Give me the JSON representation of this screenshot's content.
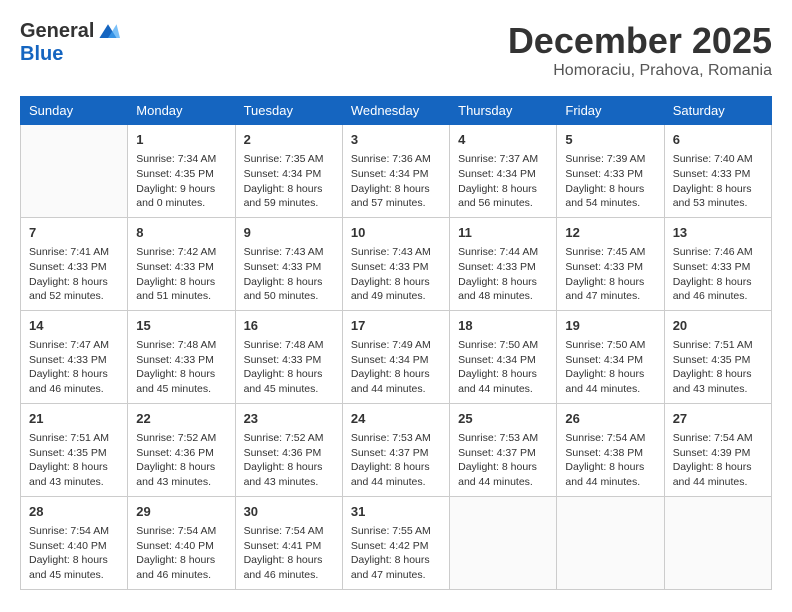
{
  "header": {
    "logo_general": "General",
    "logo_blue": "Blue",
    "month": "December 2025",
    "location": "Homoraciu, Prahova, Romania"
  },
  "days_of_week": [
    "Sunday",
    "Monday",
    "Tuesday",
    "Wednesday",
    "Thursday",
    "Friday",
    "Saturday"
  ],
  "weeks": [
    [
      {
        "day": "",
        "content": ""
      },
      {
        "day": "1",
        "content": "Sunrise: 7:34 AM\nSunset: 4:35 PM\nDaylight: 9 hours\nand 0 minutes."
      },
      {
        "day": "2",
        "content": "Sunrise: 7:35 AM\nSunset: 4:34 PM\nDaylight: 8 hours\nand 59 minutes."
      },
      {
        "day": "3",
        "content": "Sunrise: 7:36 AM\nSunset: 4:34 PM\nDaylight: 8 hours\nand 57 minutes."
      },
      {
        "day": "4",
        "content": "Sunrise: 7:37 AM\nSunset: 4:34 PM\nDaylight: 8 hours\nand 56 minutes."
      },
      {
        "day": "5",
        "content": "Sunrise: 7:39 AM\nSunset: 4:33 PM\nDaylight: 8 hours\nand 54 minutes."
      },
      {
        "day": "6",
        "content": "Sunrise: 7:40 AM\nSunset: 4:33 PM\nDaylight: 8 hours\nand 53 minutes."
      }
    ],
    [
      {
        "day": "7",
        "content": "Sunrise: 7:41 AM\nSunset: 4:33 PM\nDaylight: 8 hours\nand 52 minutes."
      },
      {
        "day": "8",
        "content": "Sunrise: 7:42 AM\nSunset: 4:33 PM\nDaylight: 8 hours\nand 51 minutes."
      },
      {
        "day": "9",
        "content": "Sunrise: 7:43 AM\nSunset: 4:33 PM\nDaylight: 8 hours\nand 50 minutes."
      },
      {
        "day": "10",
        "content": "Sunrise: 7:43 AM\nSunset: 4:33 PM\nDaylight: 8 hours\nand 49 minutes."
      },
      {
        "day": "11",
        "content": "Sunrise: 7:44 AM\nSunset: 4:33 PM\nDaylight: 8 hours\nand 48 minutes."
      },
      {
        "day": "12",
        "content": "Sunrise: 7:45 AM\nSunset: 4:33 PM\nDaylight: 8 hours\nand 47 minutes."
      },
      {
        "day": "13",
        "content": "Sunrise: 7:46 AM\nSunset: 4:33 PM\nDaylight: 8 hours\nand 46 minutes."
      }
    ],
    [
      {
        "day": "14",
        "content": "Sunrise: 7:47 AM\nSunset: 4:33 PM\nDaylight: 8 hours\nand 46 minutes."
      },
      {
        "day": "15",
        "content": "Sunrise: 7:48 AM\nSunset: 4:33 PM\nDaylight: 8 hours\nand 45 minutes."
      },
      {
        "day": "16",
        "content": "Sunrise: 7:48 AM\nSunset: 4:33 PM\nDaylight: 8 hours\nand 45 minutes."
      },
      {
        "day": "17",
        "content": "Sunrise: 7:49 AM\nSunset: 4:34 PM\nDaylight: 8 hours\nand 44 minutes."
      },
      {
        "day": "18",
        "content": "Sunrise: 7:50 AM\nSunset: 4:34 PM\nDaylight: 8 hours\nand 44 minutes."
      },
      {
        "day": "19",
        "content": "Sunrise: 7:50 AM\nSunset: 4:34 PM\nDaylight: 8 hours\nand 44 minutes."
      },
      {
        "day": "20",
        "content": "Sunrise: 7:51 AM\nSunset: 4:35 PM\nDaylight: 8 hours\nand 43 minutes."
      }
    ],
    [
      {
        "day": "21",
        "content": "Sunrise: 7:51 AM\nSunset: 4:35 PM\nDaylight: 8 hours\nand 43 minutes."
      },
      {
        "day": "22",
        "content": "Sunrise: 7:52 AM\nSunset: 4:36 PM\nDaylight: 8 hours\nand 43 minutes."
      },
      {
        "day": "23",
        "content": "Sunrise: 7:52 AM\nSunset: 4:36 PM\nDaylight: 8 hours\nand 43 minutes."
      },
      {
        "day": "24",
        "content": "Sunrise: 7:53 AM\nSunset: 4:37 PM\nDaylight: 8 hours\nand 44 minutes."
      },
      {
        "day": "25",
        "content": "Sunrise: 7:53 AM\nSunset: 4:37 PM\nDaylight: 8 hours\nand 44 minutes."
      },
      {
        "day": "26",
        "content": "Sunrise: 7:54 AM\nSunset: 4:38 PM\nDaylight: 8 hours\nand 44 minutes."
      },
      {
        "day": "27",
        "content": "Sunrise: 7:54 AM\nSunset: 4:39 PM\nDaylight: 8 hours\nand 44 minutes."
      }
    ],
    [
      {
        "day": "28",
        "content": "Sunrise: 7:54 AM\nSunset: 4:40 PM\nDaylight: 8 hours\nand 45 minutes."
      },
      {
        "day": "29",
        "content": "Sunrise: 7:54 AM\nSunset: 4:40 PM\nDaylight: 8 hours\nand 46 minutes."
      },
      {
        "day": "30",
        "content": "Sunrise: 7:54 AM\nSunset: 4:41 PM\nDaylight: 8 hours\nand 46 minutes."
      },
      {
        "day": "31",
        "content": "Sunrise: 7:55 AM\nSunset: 4:42 PM\nDaylight: 8 hours\nand 47 minutes."
      },
      {
        "day": "",
        "content": ""
      },
      {
        "day": "",
        "content": ""
      },
      {
        "day": "",
        "content": ""
      }
    ]
  ]
}
